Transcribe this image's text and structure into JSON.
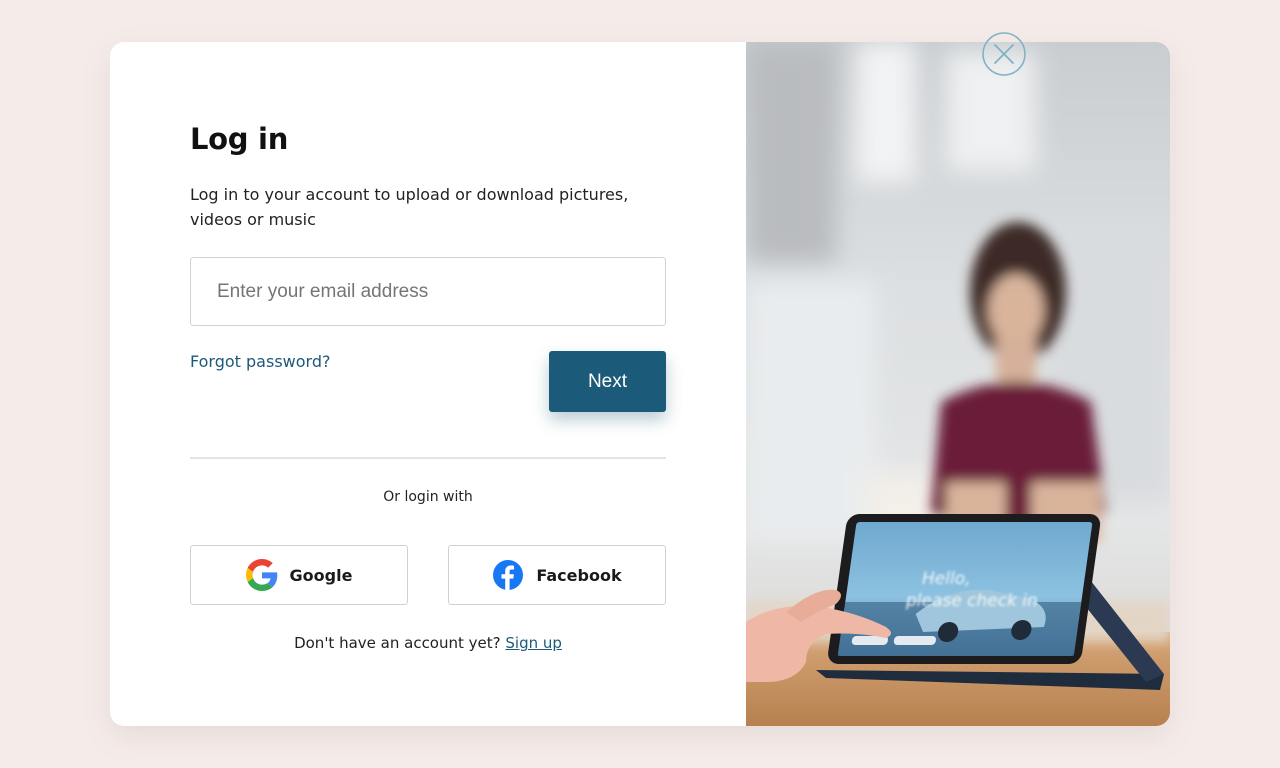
{
  "login": {
    "title": "Log in",
    "subtitle": "Log in to your account to upload or download pictures, videos or music",
    "email_placeholder": "Enter your email address",
    "email_value": "",
    "forgot_label": "Forgot password?",
    "next_label": "Next",
    "or_label": "Or login with",
    "google_label": "Google",
    "facebook_label": "Facebook",
    "no_account_label": "Don't have an account yet?",
    "signup_label": "Sign up"
  },
  "photo": {
    "tablet_text_line1": "Hello,",
    "tablet_text_line2": "please check in"
  },
  "icons": {
    "close": "close-icon",
    "google": "google-icon",
    "facebook": "facebook-icon"
  },
  "colors": {
    "page_background": "#f5ecea",
    "accent": "#1b5a78",
    "close_ring": "#7fb2c5",
    "facebook_blue": "#1877f2"
  }
}
